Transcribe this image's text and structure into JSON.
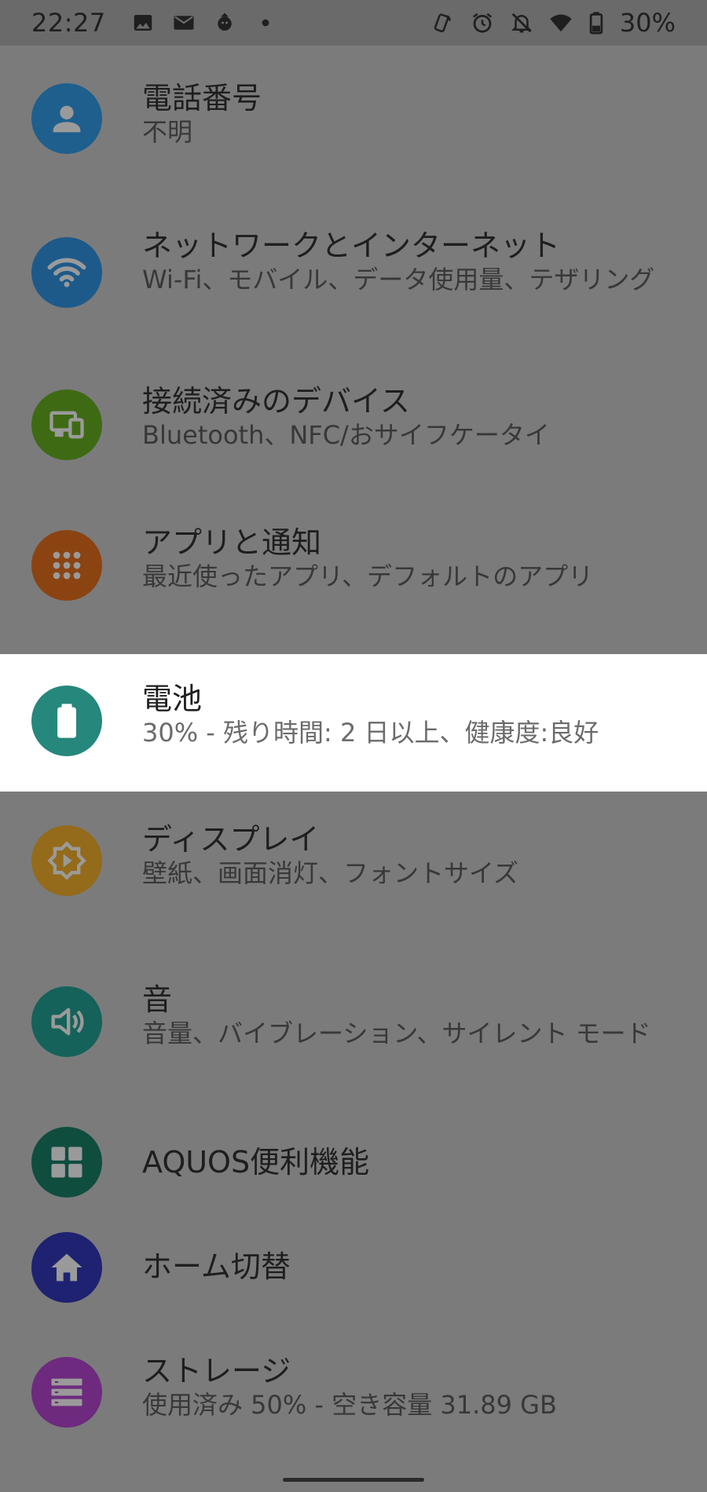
{
  "status_bar": {
    "time": "22:27",
    "battery_percent": "30%",
    "left_icons": [
      "image-icon",
      "mail-icon",
      "app-notification-icon",
      "more-dot-icon"
    ],
    "right_icons": [
      "nfc-icon",
      "alarm-icon",
      "silent-icon",
      "wifi-icon",
      "battery-icon"
    ]
  },
  "settings": {
    "items": [
      {
        "title": "電話番号",
        "summary": "不明",
        "icon": "person-icon",
        "color": "#1e5f8e"
      },
      {
        "title": "ネットワークとインターネット",
        "summary": "Wi-Fi、モバイル、データ使用量、テザリング",
        "icon": "wifi-icon",
        "color": "#1d5a8a"
      },
      {
        "title": "接続済みのデバイス",
        "summary": "Bluetooth、NFC/おサイフケータイ",
        "icon": "devices-icon",
        "color": "#3e6a14"
      },
      {
        "title": "アプリと通知",
        "summary": "最近使ったアプリ、デフォルトのアプリ",
        "icon": "apps-grid-icon",
        "color": "#8b4312"
      },
      {
        "title": "電池",
        "summary": "30% - 残り時間: 2 日以上、健康度:良好",
        "icon": "battery-icon",
        "color": "#26877c"
      },
      {
        "title": "ディスプレイ",
        "summary": "壁紙、画面消灯、フォントサイズ",
        "icon": "brightness-icon",
        "color": "#946b1a"
      },
      {
        "title": "音",
        "summary": "音量、バイブレーション、サイレント モード",
        "icon": "volume-icon",
        "color": "#15625a"
      },
      {
        "title": "AQUOS便利機能",
        "summary": "",
        "icon": "tiles-icon",
        "color": "#0f4d3f"
      },
      {
        "title": "ホーム切替",
        "summary": "",
        "icon": "home-icon",
        "color": "#1f2271"
      },
      {
        "title": "ストレージ",
        "summary": "使用済み 50% - 空き容量 31.89 GB",
        "icon": "storage-icon",
        "color": "#6e2a7e"
      }
    ]
  }
}
